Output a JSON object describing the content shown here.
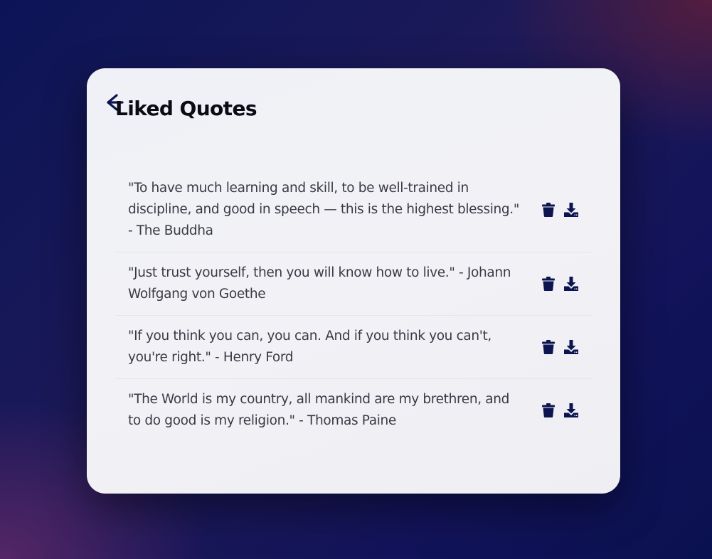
{
  "page": {
    "title": "Liked Quotes"
  },
  "icons": {
    "back": "arrow-left-icon",
    "delete": "trash-icon",
    "download": "download-icon"
  },
  "colors": {
    "icon": "#0c1550",
    "title": "#0b0b14",
    "text": "#3a3a46",
    "card": "#f1f1f5"
  },
  "quotes": [
    {
      "text": "\"To have much learning and skill, to be well-trained in discipline, and good in speech — this is the highest blessing.\" - The Buddha"
    },
    {
      "text": "\"Just trust yourself, then you will know how to live.\" - Johann Wolfgang von Goethe"
    },
    {
      "text": "\"If you think you can, you can. And if you think you can't, you're right.\" - Henry Ford"
    },
    {
      "text": "\"The World is my country, all mankind are my brethren, and to do good is my religion.\" - Thomas Paine"
    }
  ]
}
